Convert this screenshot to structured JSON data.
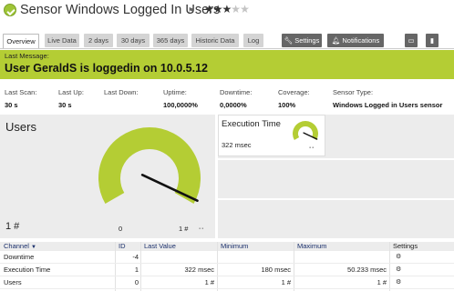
{
  "header": {
    "title": "Sensor Windows Logged In Users",
    "flag_icon": "flag-icon",
    "stars_filled": 3,
    "stars_total": 5
  },
  "tabs": [
    "Overview",
    "Live Data",
    "2 days",
    "30 days",
    "365 days",
    "Historic Data",
    "Log"
  ],
  "actions": {
    "settings": "Settings",
    "notifications": "Notifications"
  },
  "message": {
    "label": "Last Message:",
    "text": "User GeraldS is loggedin on 10.0.5.12",
    "color": "#b4cd34"
  },
  "stats": [
    {
      "label": "Last Scan:",
      "value": "30 s"
    },
    {
      "label": "Last Up:",
      "value": "30 s"
    },
    {
      "label": "Last Down:",
      "value": ""
    },
    {
      "label": "Uptime:",
      "value": "100,0000%"
    },
    {
      "label": "Downtime:",
      "value": "0,0000%"
    },
    {
      "label": "Coverage:",
      "value": "100%"
    },
    {
      "label": "Sensor Type:",
      "value": "Windows Logged in Users sensor"
    }
  ],
  "gauge_users": {
    "title": "Users",
    "value": "1 #",
    "min_label": "0",
    "max_label": "1 #",
    "level": 1.0,
    "color": "#b4cd34"
  },
  "gauge_exec": {
    "title": "Execution Time",
    "value": "322 msec",
    "level": 1.0
  },
  "table": {
    "columns": [
      "Channel",
      "ID",
      "Last Value",
      "Minimum",
      "Maximum",
      "Settings"
    ],
    "rows": [
      {
        "channel": "Downtime",
        "id": "-4",
        "last": "",
        "min": "",
        "max": ""
      },
      {
        "channel": "Execution Time",
        "id": "1",
        "last": "322 msec",
        "min": "180 msec",
        "max": "50.233 msec"
      },
      {
        "channel": "Users",
        "id": "0",
        "last": "1 #",
        "min": "1 #",
        "max": "1 #"
      }
    ]
  }
}
